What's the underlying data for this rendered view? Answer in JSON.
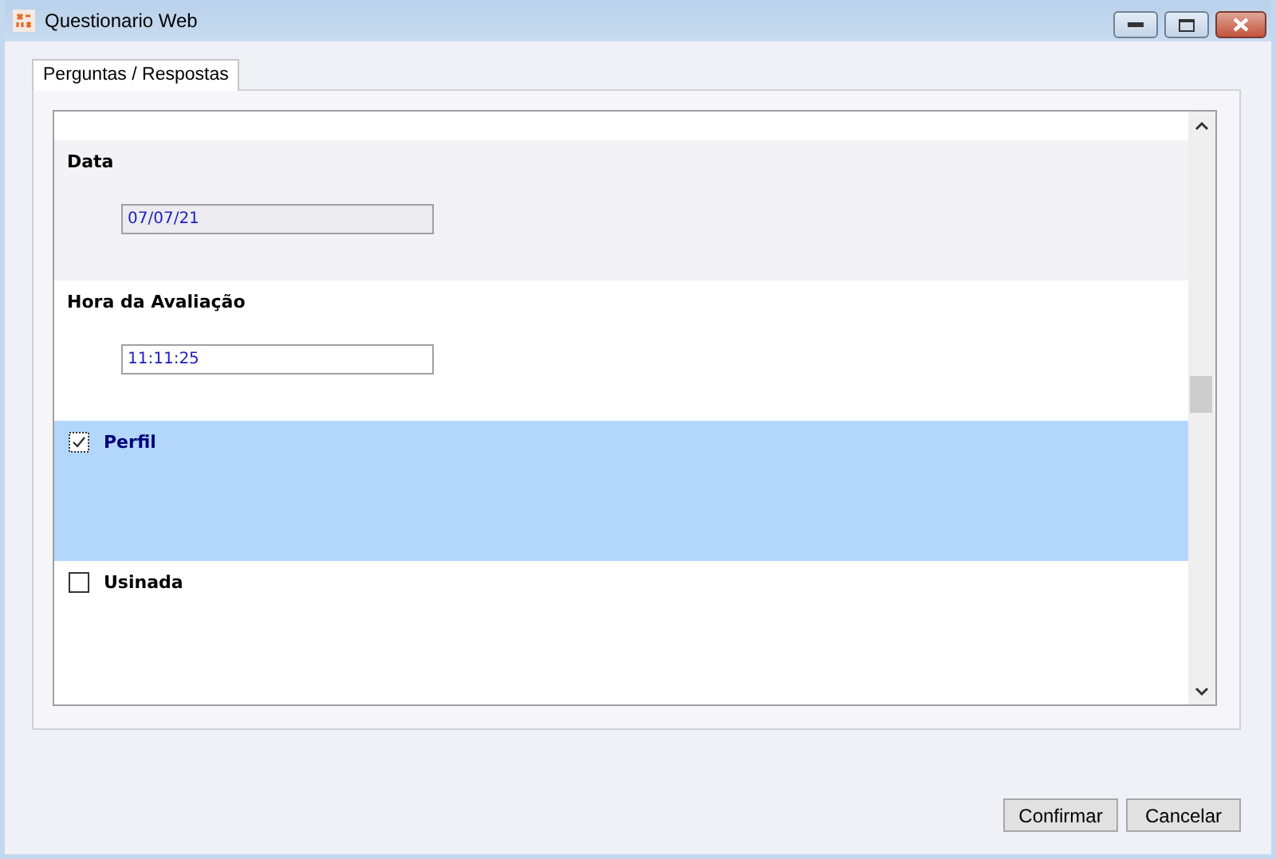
{
  "window": {
    "title": "Questionario Web"
  },
  "tabs": [
    {
      "label": "Perguntas / Respostas",
      "selected": true
    }
  ],
  "questions": [
    {
      "kind": "field",
      "label": "Data",
      "value": "07/07/21",
      "disabled": true
    },
    {
      "kind": "field",
      "label": "Hora da Avaliação",
      "value": "11:11:25",
      "disabled": false
    },
    {
      "kind": "check",
      "label": "Perfil",
      "checked": true,
      "selected": true
    },
    {
      "kind": "check",
      "label": "Usinada",
      "checked": false,
      "selected": false
    }
  ],
  "buttons": [
    "Confirmar",
    "Cancelar"
  ]
}
